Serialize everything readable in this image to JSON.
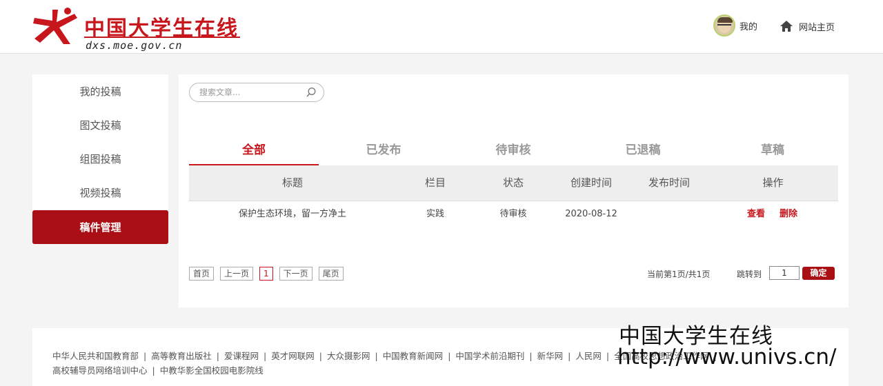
{
  "header": {
    "logo_title": "中国大学生在线",
    "logo_domain": "dxs.moe.gov.cn",
    "user_label": "我的",
    "home_label": "网站主页",
    "user_icon": "avatar",
    "home_icon": "home-icon"
  },
  "sidebar": {
    "items": [
      {
        "label": "我的投稿",
        "active": false
      },
      {
        "label": "图文投稿",
        "active": false
      },
      {
        "label": "组图投稿",
        "active": false
      },
      {
        "label": "视频投稿",
        "active": false
      },
      {
        "label": "稿件管理",
        "active": true
      }
    ]
  },
  "search": {
    "placeholder": "搜索文章...",
    "value": ""
  },
  "tabs": [
    {
      "label": "全部",
      "active": true
    },
    {
      "label": "已发布",
      "active": false
    },
    {
      "label": "待审核",
      "active": false
    },
    {
      "label": "已退稿",
      "active": false
    },
    {
      "label": "草稿",
      "active": false
    }
  ],
  "table": {
    "columns": [
      "标题",
      "栏目",
      "状态",
      "创建时间",
      "发布时间",
      "操作"
    ],
    "rows": [
      {
        "title": "保护生态环境，留一方净土",
        "column": "实践",
        "status": "待审核",
        "created": "2020-08-12",
        "published": "",
        "actions": [
          "查看",
          "删除"
        ]
      }
    ]
  },
  "pager": {
    "first": "首页",
    "prev": "上一页",
    "current": "1",
    "next": "下一页",
    "last": "尾页",
    "info": "当前第1页/共1页",
    "jump_label": "跳转到",
    "jump_value": "1",
    "confirm": "确定"
  },
  "footer": {
    "links": [
      "中华人民共和国教育部",
      "高等教育出版社",
      "爱课程网",
      "英才网联网",
      "大众摄影网",
      "中国教育新闻网",
      "中国学术前沿期刊",
      "新华网",
      "人民网",
      "全国高校思想政治工作网",
      "高校辅导员网络培训中心",
      "中教华影全国校园电影院线"
    ]
  },
  "watermark": {
    "line1": "中国大学生在线",
    "line2": "http://www.univs.cn/"
  },
  "colors": {
    "brand_red": "#c8161d",
    "dark_red": "#a90f14",
    "page_bg": "#f4f4f4"
  }
}
